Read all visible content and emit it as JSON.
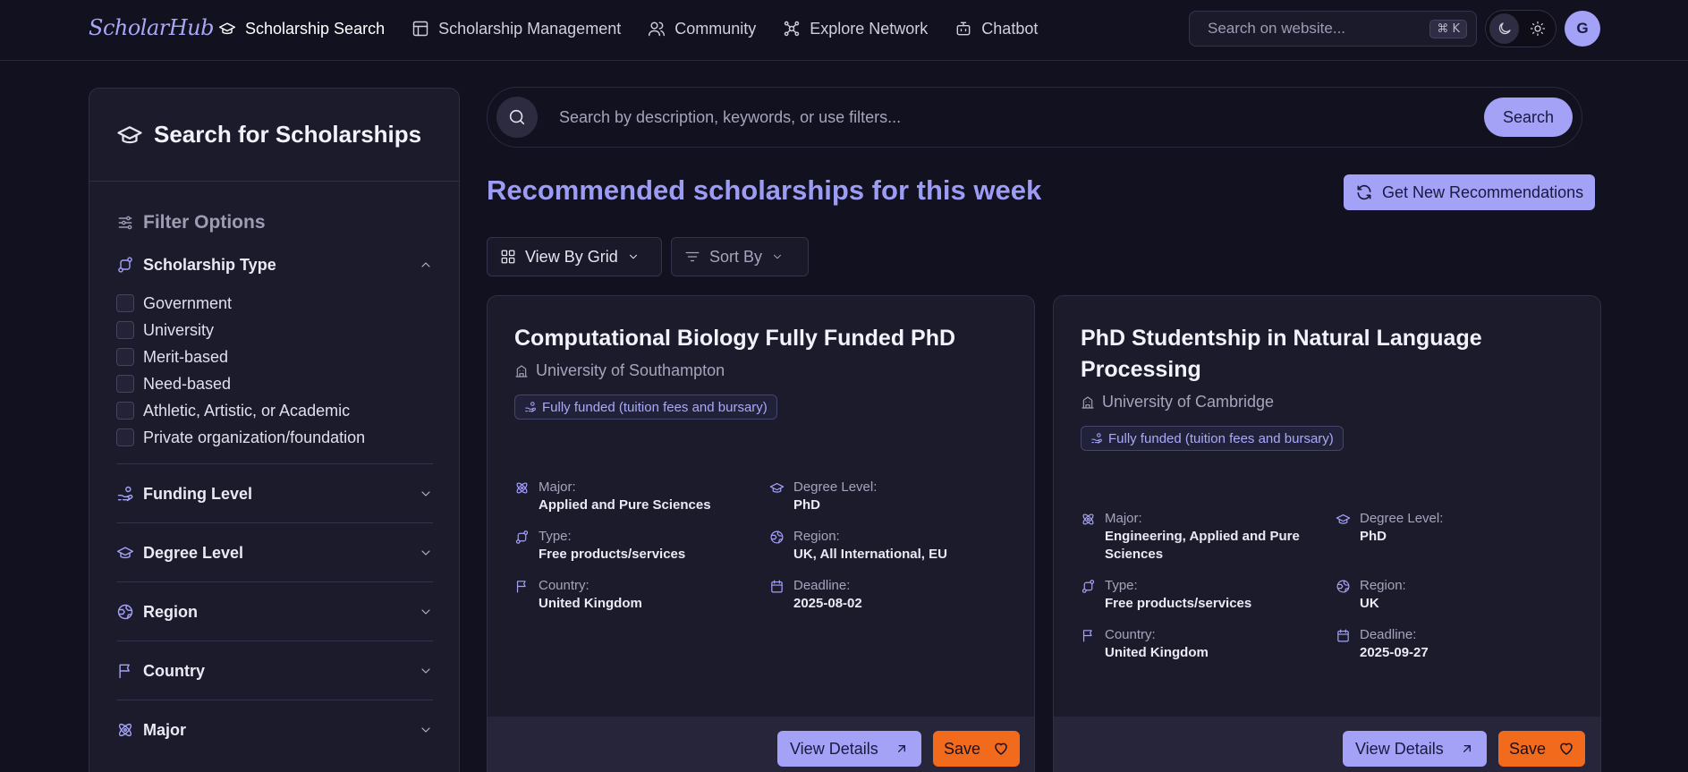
{
  "nav": {
    "logo": "ScholarHub",
    "links": [
      {
        "label": "Scholarship Search",
        "icon": "graduation-cap-icon",
        "active": true
      },
      {
        "label": "Scholarship Management",
        "icon": "table-icon"
      },
      {
        "label": "Community",
        "icon": "users-icon"
      },
      {
        "label": "Explore Network",
        "icon": "network-icon"
      },
      {
        "label": "Chatbot",
        "icon": "bot-icon"
      }
    ],
    "search_placeholder": "Search on website...",
    "shortcut": "⌘ K",
    "avatar_initial": "G"
  },
  "sidebar": {
    "title": "Search for Scholarships",
    "filter_heading": "Filter Options",
    "scholarship_type": {
      "label": "Scholarship Type",
      "options": [
        "Government",
        "University",
        "Merit-based",
        "Need-based",
        "Athletic, Artistic, or Academic",
        "Private organization/foundation"
      ]
    },
    "sections": [
      "Funding Level",
      "Degree Level",
      "Region",
      "Country",
      "Major"
    ]
  },
  "main": {
    "search_placeholder": "Search by description, keywords, or use filters...",
    "search_button": "Search",
    "heading": "Recommended scholarships for this week",
    "recommend_button": "Get New Recommendations",
    "view_control": "View By Grid",
    "sort_control": "Sort By"
  },
  "cards": [
    {
      "title": "Computational Biology Fully Funded PhD",
      "institution": "University of Southampton",
      "funding": "Fully funded (tuition fees and bursary)",
      "major_label": "Major:",
      "major": "Applied and Pure Sciences",
      "degree_label": "Degree Level:",
      "degree": "PhD",
      "type_label": "Type:",
      "type": "Free products/services",
      "region_label": "Region:",
      "region": "UK, All International, EU",
      "country_label": "Country:",
      "country": "United Kingdom",
      "deadline_label": "Deadline:",
      "deadline": "2025-08-02",
      "view_button": "View Details",
      "save_button": "Save"
    },
    {
      "title": "PhD Studentship in Natural Language Processing",
      "institution": "University of Cambridge",
      "funding": "Fully funded (tuition fees and bursary)",
      "major_label": "Major:",
      "major": "Engineering, Applied and Pure Sciences",
      "degree_label": "Degree Level:",
      "degree": "PhD",
      "type_label": "Type:",
      "type": "Free products/services",
      "region_label": "Region:",
      "region": "UK",
      "country_label": "Country:",
      "country": "United Kingdom",
      "deadline_label": "Deadline:",
      "deadline": "2025-09-27",
      "view_button": "View Details",
      "save_button": "Save"
    }
  ],
  "colors": {
    "accent": "#a3a2f7",
    "save": "#f26a1b",
    "background": "#12111f",
    "panel": "#1c1b2c"
  }
}
